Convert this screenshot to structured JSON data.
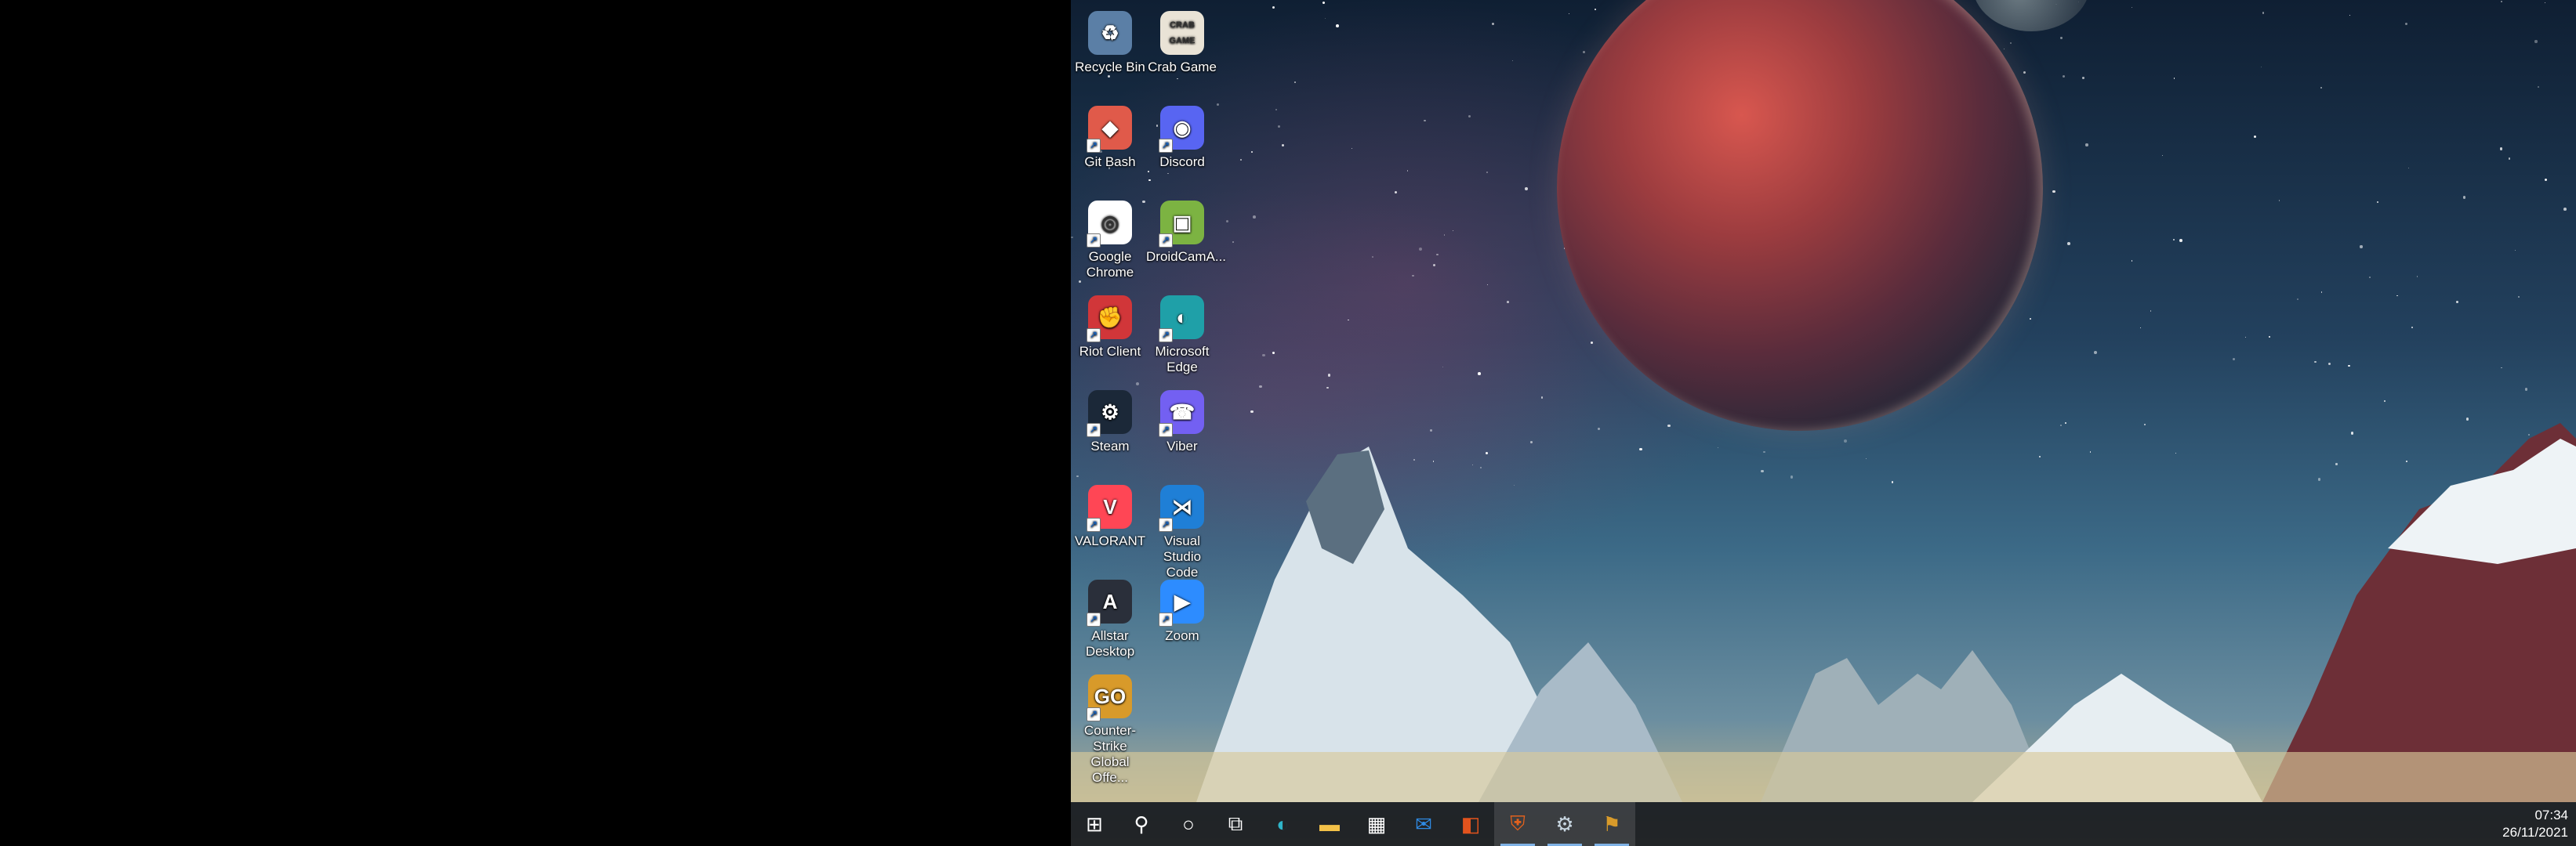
{
  "desktop": {
    "icons": [
      {
        "label": "Recycle Bin",
        "color": "#5b7fa6",
        "glyph": "♻"
      },
      {
        "label": "Crab Game",
        "color": "#e9e3d6",
        "glyph": "CRAB GAME"
      },
      {
        "label": "Git Bash",
        "color": "#e05a4a",
        "glyph": "◆"
      },
      {
        "label": "Discord",
        "color": "#5865f2",
        "glyph": "◉"
      },
      {
        "label": "Google Chrome",
        "color": "#ffffff",
        "glyph": "◎"
      },
      {
        "label": "DroidCamA...",
        "color": "#7cb342",
        "glyph": "▣"
      },
      {
        "label": "Riot Client",
        "color": "#d13639",
        "glyph": "✊"
      },
      {
        "label": "Microsoft Edge",
        "color": "#1fa0a8",
        "glyph": "◐"
      },
      {
        "label": "Steam",
        "color": "#1b2838",
        "glyph": "⚙"
      },
      {
        "label": "Viber",
        "color": "#7360f2",
        "glyph": "☎"
      },
      {
        "label": "VALORANT",
        "color": "#ff4655",
        "glyph": "V"
      },
      {
        "label": "Visual Studio Code",
        "color": "#1f7fd6",
        "glyph": "⋊"
      },
      {
        "label": "Allstar Desktop",
        "color": "#2a2f3a",
        "glyph": "A"
      },
      {
        "label": "Zoom",
        "color": "#2d8cff",
        "glyph": "▶"
      },
      {
        "label": "Counter-Strike Global Offe...",
        "color": "#d89a2a",
        "glyph": "GO"
      }
    ]
  },
  "taskbar": {
    "buttons": [
      {
        "name": "start-button",
        "icon": "windows-icon",
        "glyph": "⊞",
        "color": "#ffffff"
      },
      {
        "name": "search-button",
        "icon": "search-icon",
        "glyph": "⚲",
        "color": "#ffffff"
      },
      {
        "name": "cortana-button",
        "icon": "cortana-icon",
        "glyph": "○",
        "color": "#ffffff"
      },
      {
        "name": "task-view-button",
        "icon": "task-view-icon",
        "glyph": "⧉",
        "color": "#ffffff"
      },
      {
        "name": "edge-button",
        "icon": "edge-icon",
        "glyph": "◐",
        "color": "#2fb5c9"
      },
      {
        "name": "file-explorer-button",
        "icon": "folder-icon",
        "glyph": "▬",
        "color": "#f3c148"
      },
      {
        "name": "store-button",
        "icon": "store-icon",
        "glyph": "▦",
        "color": "#ffffff"
      },
      {
        "name": "mail-button",
        "icon": "mail-icon",
        "glyph": "✉",
        "color": "#2f8ae3"
      },
      {
        "name": "office-button",
        "icon": "office-icon",
        "glyph": "◧",
        "color": "#e2531d"
      },
      {
        "name": "shield-app-button",
        "icon": "shield-icon",
        "glyph": "⛨",
        "color": "#e2611d"
      },
      {
        "name": "steam-button",
        "icon": "steam-icon",
        "glyph": "⚙",
        "color": "#c7d5e0"
      },
      {
        "name": "csgo-button",
        "icon": "csgo-icon",
        "glyph": "⚑",
        "color": "#d89a2a"
      }
    ],
    "clock": {
      "time": "07:34",
      "date": "26/11/2021"
    }
  }
}
